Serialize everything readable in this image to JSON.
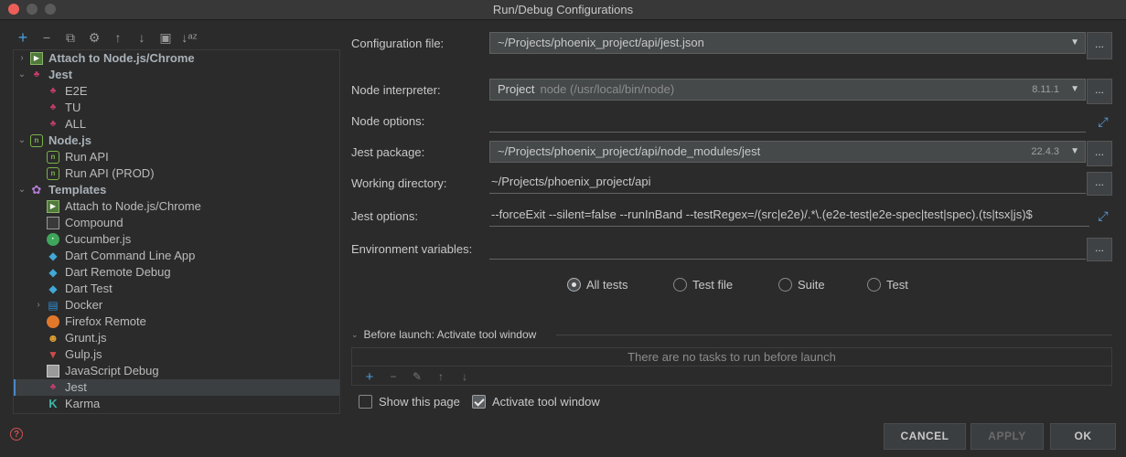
{
  "window": {
    "title": "Run/Debug Configurations",
    "traffic": [
      "#ec5f58",
      "#5a5a5a",
      "#5a5a5a"
    ]
  },
  "toolbar": {
    "add": "+",
    "remove": "−",
    "copy": "⧉",
    "settings": "⚙",
    "up": "↑",
    "down": "↓",
    "folder": "▣",
    "sort": "↓ᵃᶻ"
  },
  "tree": {
    "items": [
      {
        "label": "Attach to Node.js/Chrome",
        "level": 0,
        "arrow": "›",
        "icon": "attach-icon",
        "bold": true
      },
      {
        "label": "Jest",
        "level": 0,
        "arrow": "⌄",
        "icon": "jest-icon",
        "bold": true
      },
      {
        "label": "E2E",
        "level": 1,
        "icon": "jest-icon"
      },
      {
        "label": "TU",
        "level": 1,
        "icon": "jest-icon"
      },
      {
        "label": "ALL",
        "level": 1,
        "icon": "jest-icon"
      },
      {
        "label": "Node.js",
        "level": 0,
        "arrow": "⌄",
        "icon": "nodejs-icon",
        "bold": true
      },
      {
        "label": "Run API",
        "level": 1,
        "icon": "nodejs-icon"
      },
      {
        "label": "Run API (PROD)",
        "level": 1,
        "icon": "nodejs-icon"
      },
      {
        "label": "Templates",
        "level": 0,
        "arrow": "⌄",
        "icon": "gear-icon",
        "bold": true
      },
      {
        "label": "Attach to Node.js/Chrome",
        "level": 1,
        "icon": "attach-icon"
      },
      {
        "label": "Compound",
        "level": 1,
        "icon": "compound-icon"
      },
      {
        "label": "Cucumber.js",
        "level": 1,
        "icon": "cucumber-icon"
      },
      {
        "label": "Dart Command Line App",
        "level": 1,
        "icon": "dart-icon"
      },
      {
        "label": "Dart Remote Debug",
        "level": 1,
        "icon": "dart-icon"
      },
      {
        "label": "Dart Test",
        "level": 1,
        "icon": "dart-icon"
      },
      {
        "label": "Docker",
        "level": 1,
        "arrow": "›",
        "icon": "docker-icon"
      },
      {
        "label": "Firefox Remote",
        "level": 1,
        "icon": "firefox-icon"
      },
      {
        "label": "Grunt.js",
        "level": 1,
        "icon": "grunt-icon"
      },
      {
        "label": "Gulp.js",
        "level": 1,
        "icon": "gulp-icon"
      },
      {
        "label": "JavaScript Debug",
        "level": 1,
        "icon": "javascript-debug-icon"
      },
      {
        "label": "Jest",
        "level": 1,
        "icon": "jest-icon",
        "selected": true
      },
      {
        "label": "Karma",
        "level": 1,
        "icon": "karma-icon"
      }
    ]
  },
  "form": {
    "config_file_label": "Configuration file:",
    "config_file_value": "~/Projects/phoenix_project/api/jest.json",
    "node_interpreter_label": "Node interpreter:",
    "node_interpreter_name": "Project",
    "node_interpreter_path": "node (/usr/local/bin/node)",
    "node_interpreter_version": "8.11.1",
    "node_options_label": "Node options:",
    "node_options_value": "",
    "jest_package_label": "Jest package:",
    "jest_package_value": "~/Projects/phoenix_project/api/node_modules/jest",
    "jest_package_version": "22.4.3",
    "working_dir_label": "Working directory:",
    "working_dir_value": "~/Projects/phoenix_project/api",
    "jest_options_label": "Jest options:",
    "jest_options_value": "--forceExit --silent=false --runInBand --testRegex=/(src|e2e)/.*\\.(e2e-test|e2e-spec|test|spec).(ts|tsx|js)$",
    "env_vars_label": "Environment variables:",
    "env_vars_value": "",
    "ellipsis": "...",
    "dropdown": "▼",
    "expand": "⤢"
  },
  "scope": {
    "options": [
      "All tests",
      "Test file",
      "Suite",
      "Test"
    ],
    "selected": "All tests"
  },
  "before_launch": {
    "title": "Before launch: Activate tool window",
    "empty": "There are no tasks to run before launch",
    "tools": [
      "+",
      "−",
      "✎",
      "↑",
      "↓"
    ]
  },
  "checkboxes": {
    "show_page": "Show this page",
    "show_page_checked": false,
    "activate_window": "Activate tool window",
    "activate_window_checked": true
  },
  "buttons": {
    "cancel": "CANCEL",
    "apply": "APPLY",
    "ok": "OK"
  },
  "help": "?"
}
